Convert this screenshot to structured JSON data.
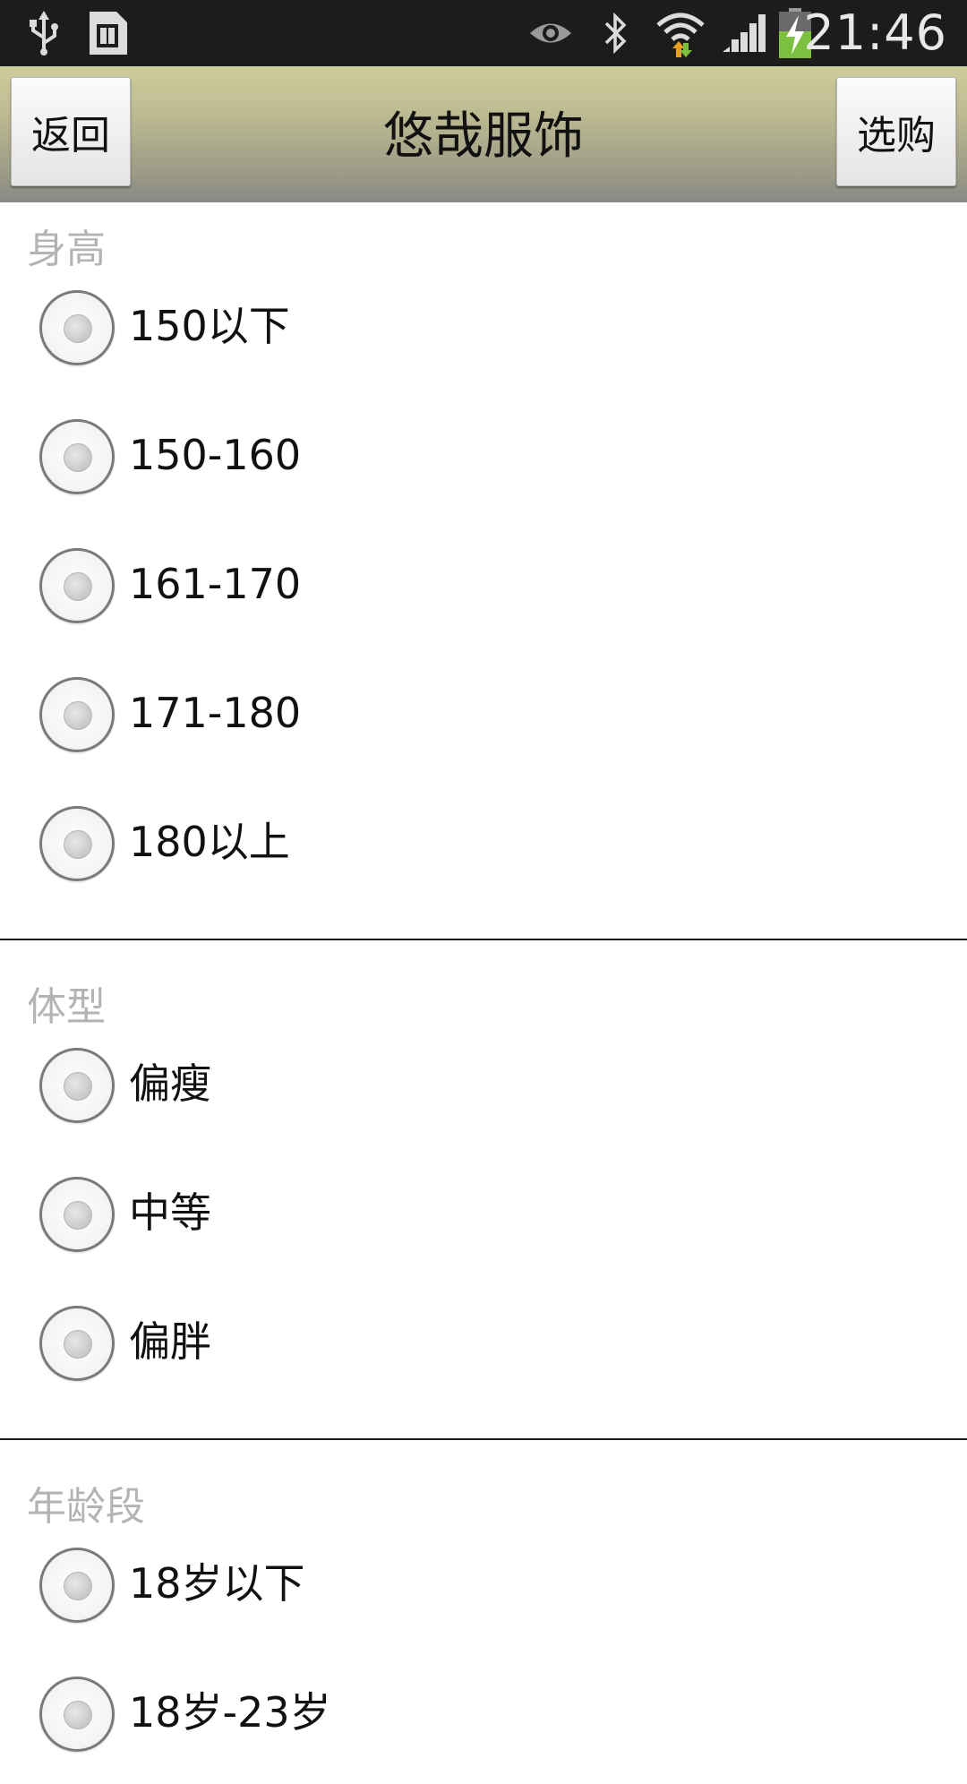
{
  "status_bar": {
    "time": "21:46",
    "icons": [
      "usb-icon",
      "sim-card-icon",
      "eye-icon",
      "bluetooth-icon",
      "wifi-icon",
      "signal-icon",
      "battery-charging-icon"
    ]
  },
  "title_bar": {
    "back_label": "返回",
    "title": "悠哉服饰",
    "buy_label": "选购"
  },
  "sections": [
    {
      "title": "身高",
      "options": [
        "150以下",
        "150-160",
        "161-170",
        "171-180",
        "180以上"
      ]
    },
    {
      "title": "体型",
      "options": [
        "偏瘦",
        "中等",
        "偏胖"
      ]
    },
    {
      "title": "年龄段",
      "options": [
        "18岁以下",
        "18岁-23岁"
      ]
    }
  ],
  "colors": {
    "status_bar_bg": "#1c1c1c",
    "title_bar_top": "#cfcd9c",
    "title_bar_bottom": "#8a8a86",
    "section_title": "#b4b4b4",
    "divider": "#1a1a1a"
  }
}
